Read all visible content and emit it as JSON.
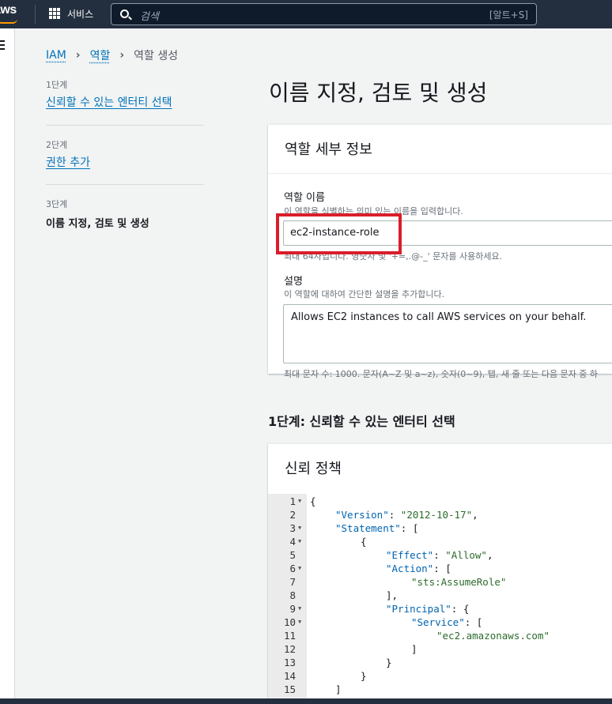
{
  "topnav": {
    "logo": "aws",
    "services_label": "서비스",
    "search_placeholder": "검색",
    "search_shortcut": "[알트+S]"
  },
  "breadcrumb": {
    "items": [
      "IAM",
      "역할"
    ],
    "current": "역할 생성"
  },
  "steps": [
    {
      "num": "1단계",
      "label": "신뢰할 수 있는 엔터티 선택"
    },
    {
      "num": "2단계",
      "label": "권한 추가"
    },
    {
      "num": "3단계",
      "label": "이름 지정, 검토 및 생성"
    }
  ],
  "page_title": "이름 지정, 검토 및 생성",
  "details_panel": {
    "title": "역할 세부 정보",
    "role_name_label": "역할 이름",
    "role_name_desc": "이 역할을 식별하는 의미 있는 이름을 입력합니다.",
    "role_name_value": "ec2-instance-role",
    "role_name_hint": "최대 64자입니다. 영숫자 및 '+=,.@-_' 문자를 사용하세요.",
    "desc_label": "설명",
    "desc_desc": "이 역할에 대하여 간단한 설명을 추가합니다.",
    "desc_value": "Allows EC2 instances to call AWS services on your behalf.",
    "desc_hint": "최대 문자 수: 1000. 문자(A~Z 및 a~z), 숫자(0~9), 탭, 새 줄 또는 다음 문자 중 하"
  },
  "step1_heading": "1단계: 신뢰할 수 있는 엔터티 선택",
  "trust_panel": {
    "title": "신뢰 정책"
  },
  "code_lines": [
    {
      "n": "1",
      "fold": true
    },
    {
      "n": "2",
      "fold": false
    },
    {
      "n": "3",
      "fold": true
    },
    {
      "n": "4",
      "fold": true
    },
    {
      "n": "5",
      "fold": false
    },
    {
      "n": "6",
      "fold": true
    },
    {
      "n": "7",
      "fold": false
    },
    {
      "n": "8",
      "fold": false
    },
    {
      "n": "9",
      "fold": true
    },
    {
      "n": "10",
      "fold": true
    },
    {
      "n": "11",
      "fold": false
    },
    {
      "n": "12",
      "fold": false
    },
    {
      "n": "13",
      "fold": false
    },
    {
      "n": "14",
      "fold": false
    },
    {
      "n": "15",
      "fold": false
    }
  ],
  "code": {
    "l1": "{",
    "l2_key": "\"Version\"",
    "l2_val": "\"2012-10-17\"",
    "l3_key": "\"Statement\"",
    "l4": "{",
    "l5_key": "\"Effect\"",
    "l5_val": "\"Allow\"",
    "l6_key": "\"Action\"",
    "l7_val": "\"sts:AssumeRole\"",
    "l8": "],",
    "l9_key": "\"Principal\"",
    "l10_key": "\"Service\"",
    "l11_val": "\"ec2.amazonaws.com\"",
    "l12": "]",
    "l13": "}",
    "l14": "}",
    "l15": "]"
  }
}
